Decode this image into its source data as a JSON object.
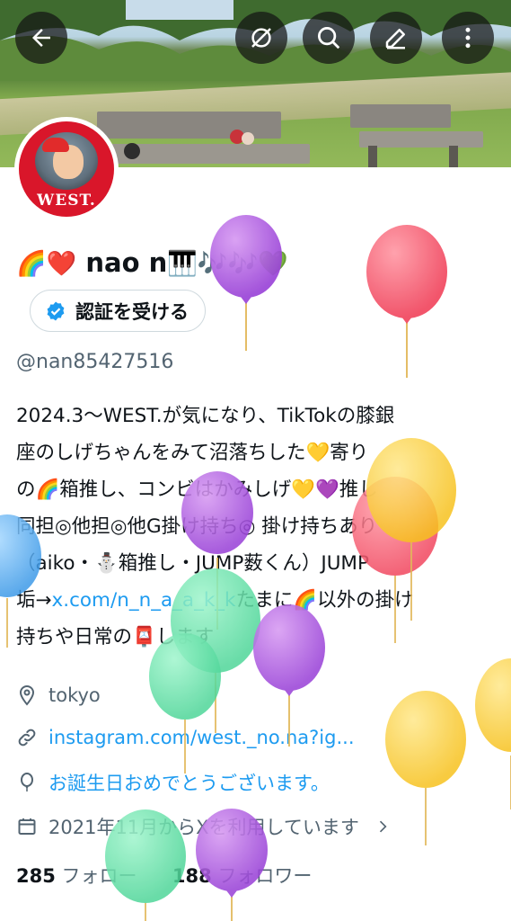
{
  "header": {
    "back_icon": "arrow-left-icon",
    "buttons": [
      "hide-icon",
      "search-icon",
      "edit-icon",
      "more-icon"
    ]
  },
  "profile": {
    "avatar_text": "WEST.",
    "display_name_emoji_prefix": "🌈❤️",
    "display_name": "nao n",
    "display_name_emoji_suffix": "🎹🎶🎶💚",
    "verify_label": "認証を受ける",
    "handle": "@nan85427516",
    "bio_lines": [
      "2024.3〜WEST.が気になり、TikTokの膝銀",
      "座のしげちゃんをみて沼落ちした💛寄り",
      "の🌈箱推し、コンビはかみしげ💛💜推し",
      "同担◎他担◎他G掛け持ち◎ 掛け持ちあり",
      "（aiko・⛄箱推し・JUMP薮くん）JUMP",
      "垢→",
      "たまに🌈以外の掛け",
      "持ちや日常の📮します"
    ],
    "bio_link": "x.com/n_n_a_a_k_k",
    "location": "tokyo",
    "website": "instagram.com/west._no.na?ig...",
    "birthday": "お誕生日おめでとうございます。",
    "joined": "2021年11月からXを利用しています",
    "following_count": "285",
    "following_label": "フォロー",
    "followers_count": "188",
    "followers_label": "フォロワー"
  },
  "colors": {
    "link": "#1d9bf0",
    "secondary_text": "#536471",
    "avatar_bg": "#d9162a"
  }
}
